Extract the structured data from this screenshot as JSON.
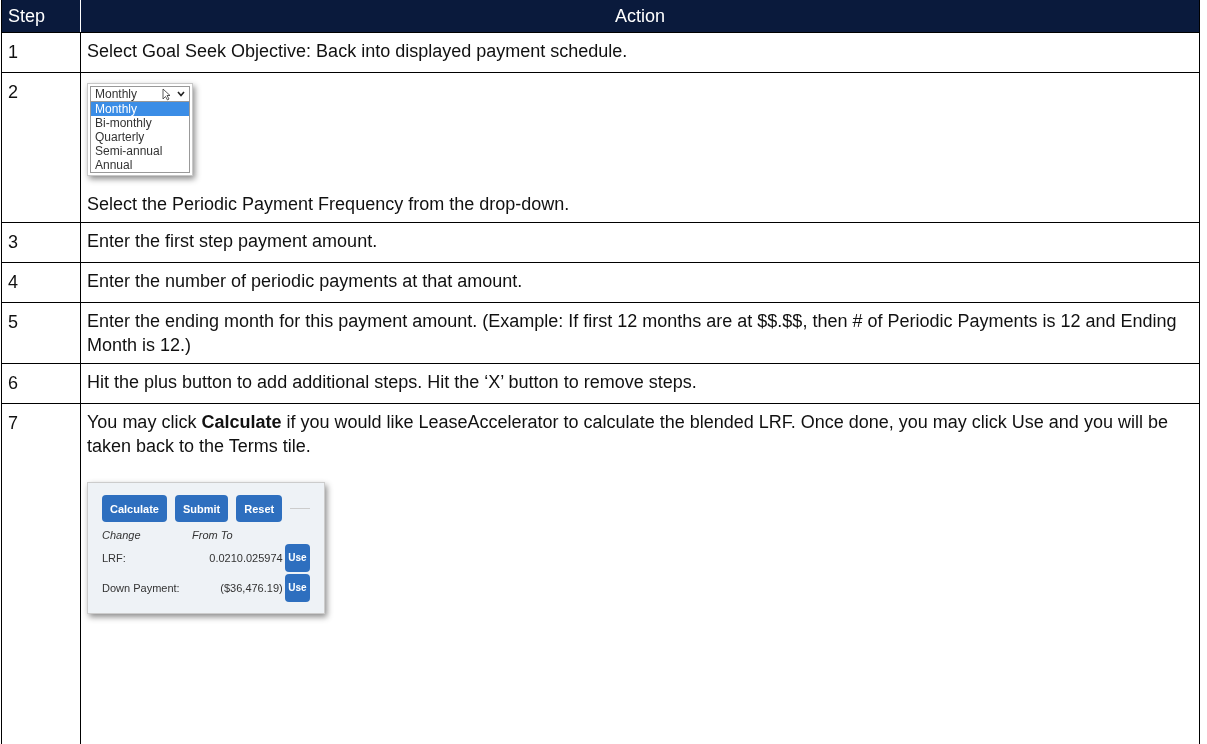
{
  "table": {
    "columns": [
      "Step",
      "Action"
    ],
    "rows": [
      {
        "step": "1",
        "content": [
          {
            "kind": "text",
            "text": "Select Goal Seek Objective: Back into displayed payment schedule."
          }
        ]
      },
      {
        "step": "2",
        "content": [
          {
            "kind": "dropdown",
            "value": "Monthly",
            "options": [
              {
                "label": "Monthly",
                "selected": true
              },
              {
                "label": "Bi-monthly",
                "selected": false
              },
              {
                "label": "Quarterly",
                "selected": false
              },
              {
                "label": "Semi-annual",
                "selected": false
              },
              {
                "label": "Annual",
                "selected": false
              }
            ]
          },
          {
            "kind": "text",
            "text": "Select the Periodic Payment Frequency from the drop-down."
          }
        ]
      },
      {
        "step": "3",
        "content": [
          {
            "kind": "text",
            "text": "Enter the first step payment amount."
          }
        ]
      },
      {
        "step": "4",
        "content": [
          {
            "kind": "text",
            "text": "Enter the number of periodic payments at that amount."
          }
        ]
      },
      {
        "step": "5",
        "content": [
          {
            "kind": "text",
            "text": "Enter the ending month for this payment amount. (Example: If first 12 months are at $$.$$, then # of Periodic Payments is 12 and Ending Month is 12.)"
          }
        ]
      },
      {
        "step": "6",
        "content": [
          {
            "kind": "text",
            "text": "Hit the plus button to add additional steps. Hit the ‘X’ button to remove steps."
          }
        ]
      },
      {
        "step": "7",
        "content": [
          {
            "kind": "text",
            "text": "You may click **Calculate** if you would like LeaseAccelerator to calculate the blended LRF. Once done, you may click Use and you will be taken back to the Terms tile."
          },
          {
            "kind": "panel",
            "buttons": [
              "Calculate",
              "Submit",
              "Reset"
            ],
            "headers": [
              "Change",
              "From To"
            ],
            "lines": [
              {
                "label": "LRF:",
                "value": "0.0210.025974",
                "button": "Use"
              },
              {
                "label": "Down Payment:",
                "value": "($36,476.19)",
                "button": "Use"
              }
            ]
          }
        ]
      }
    ]
  }
}
